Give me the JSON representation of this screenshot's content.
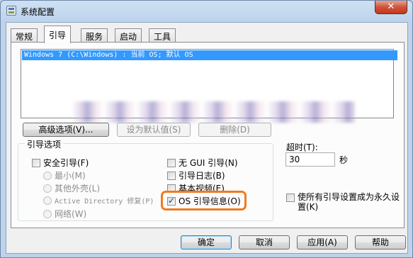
{
  "window": {
    "title": "系统配置",
    "close_glyph": "✕"
  },
  "tabs": [
    {
      "label": "常规"
    },
    {
      "label": "引导"
    },
    {
      "label": "服务"
    },
    {
      "label": "启动"
    },
    {
      "label": "工具"
    }
  ],
  "active_tab": "引导",
  "os_list": {
    "items": [
      "Windows 7 (C:\\Windows) : 当前 OS; 默认 OS"
    ],
    "selected_index": 0
  },
  "boot_buttons": {
    "advanced": "高级选项(V)...",
    "set_default": "设为默认值(S)",
    "delete": "删除(D)"
  },
  "boot_options": {
    "legend": "引导选项",
    "safe_boot": {
      "label": "安全引导(F)",
      "checked": false
    },
    "minimal": "最小(M)",
    "alternate_shell": "其他外壳(L)",
    "ad_repair": "Active Directory 修复(P)",
    "network": "网络(W)",
    "no_gui": {
      "label": "无 GUI 引导(N)",
      "checked": false
    },
    "boot_log": {
      "label": "引导日志(B)",
      "checked": false
    },
    "base_video": {
      "label": "基本视频(E)",
      "checked": false
    },
    "os_boot_info": {
      "label": "OS 引导信息(O)",
      "checked": true
    }
  },
  "timeout": {
    "label": "超时(T):",
    "value": "30",
    "unit": "秒"
  },
  "make_permanent": {
    "label": "使所有引导设置成为永久设置(K)",
    "checked": false
  },
  "footer_buttons": {
    "ok": "确定",
    "cancel": "取消",
    "apply": "应用(A)",
    "help": "帮助"
  },
  "colors": {
    "selection": "#3399ff",
    "highlight_outline": "#ee7b21",
    "close_button": "#c1391d"
  }
}
